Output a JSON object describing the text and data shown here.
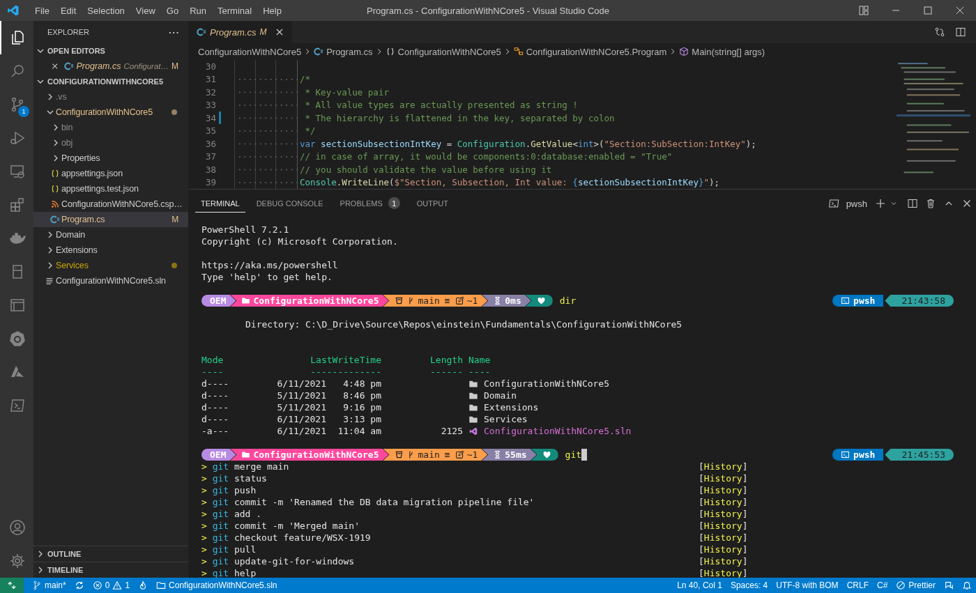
{
  "window": {
    "title": "Program.cs - ConfigurationWithNCore5 - Visual Studio Code"
  },
  "menu": [
    "File",
    "Edit",
    "Selection",
    "View",
    "Go",
    "Run",
    "Terminal",
    "Help"
  ],
  "activity_bar": {
    "top": [
      {
        "kind": "explorer",
        "selected": true
      },
      {
        "kind": "search",
        "selected": false
      },
      {
        "kind": "source_control",
        "selected": false,
        "badge": "1"
      },
      {
        "kind": "run_debug",
        "selected": false
      },
      {
        "kind": "remote",
        "selected": false
      },
      {
        "kind": "extensions",
        "selected": false
      },
      {
        "kind": "docker",
        "selected": false
      },
      {
        "kind": "device",
        "selected": false
      },
      {
        "kind": "window",
        "selected": false
      },
      {
        "kind": "kubernetes",
        "selected": false
      },
      {
        "kind": "azure",
        "selected": false
      },
      {
        "kind": "powershell",
        "selected": false
      }
    ],
    "bottom": [
      {
        "kind": "account"
      },
      {
        "kind": "settings"
      }
    ]
  },
  "sidebar": {
    "title": "EXPLORER",
    "more": "···",
    "open_editors": {
      "title": "OPEN EDITORS",
      "expanded": true,
      "items": [
        {
          "label": "Program.cs",
          "description": "Configurat…",
          "badge": "M",
          "kind": "csharp",
          "selected": false
        }
      ]
    },
    "project": {
      "title": "CONFIGURATIONWITHNCORE5",
      "expanded": true,
      "items": [
        {
          "label": ".vs",
          "kind": "folder",
          "expanded": false,
          "color": "#8c8c8c",
          "dot": false,
          "selected": false
        },
        {
          "label": "ConfigurationWithNCore5",
          "kind": "folder",
          "expanded": true,
          "color": "#e2c08d",
          "dot": true,
          "selected": false,
          "children": [
            {
              "label": "bin",
              "kind": "folder",
              "expanded": false,
              "color": "#8c8c8c",
              "dot": false,
              "selected": false
            },
            {
              "label": "obj",
              "kind": "folder",
              "expanded": false,
              "color": "#8c8c8c",
              "dot": false,
              "selected": false
            },
            {
              "label": "Properties",
              "kind": "folder",
              "expanded": false,
              "color": "#cccccc",
              "dot": false,
              "selected": false
            },
            {
              "label": "appsettings.json",
              "kind": "json",
              "color": "#cccccc",
              "dot": false,
              "selected": false
            },
            {
              "label": "appsettings.test.json",
              "kind": "json",
              "color": "#cccccc",
              "dot": false,
              "selected": false
            },
            {
              "label": "ConfigurationWithNCore5.csp…",
              "kind": "csproj",
              "color": "#cccccc",
              "dot": false,
              "selected": false
            },
            {
              "label": "Program.cs",
              "kind": "csharp",
              "color": "#e2c08d",
              "badge": "M",
              "dot": false,
              "selected": true
            }
          ]
        },
        {
          "label": "Domain",
          "kind": "folder",
          "expanded": false,
          "color": "#cccccc",
          "dot": false,
          "selected": false
        },
        {
          "label": "Extensions",
          "kind": "folder",
          "expanded": false,
          "color": "#cccccc",
          "dot": false,
          "selected": false
        },
        {
          "label": "Services",
          "kind": "folder",
          "expanded": false,
          "color": "#cca700",
          "dot": true,
          "selected": false
        },
        {
          "label": "ConfigurationWithNCore5.sln",
          "kind": "sln",
          "color": "#cccccc",
          "dot": false,
          "selected": false
        }
      ]
    },
    "sections": [
      {
        "title": "OUTLINE",
        "expanded": false
      },
      {
        "title": "TIMELINE",
        "expanded": false
      }
    ]
  },
  "editor": {
    "tabs": [
      {
        "label": "Program.cs",
        "badge": "M",
        "preview": true,
        "selected": true
      }
    ],
    "breadcrumbs": [
      {
        "kind": "folder",
        "text": "ConfigurationWithNCore5"
      },
      {
        "kind": "csharp",
        "text": "Program.cs"
      },
      {
        "kind": "namespace",
        "text": "ConfigurationWithNCore5"
      },
      {
        "kind": "class",
        "text": "ConfigurationWithNCore5.Program"
      },
      {
        "kind": "method",
        "text": "Main(string[] args)"
      }
    ],
    "lines": [
      {
        "number": "30",
        "changed": false
      },
      {
        "number": "31",
        "changed": false,
        "tokens": [
          {
            "kind": "comment",
            "text": "/*"
          }
        ]
      },
      {
        "number": "32",
        "changed": false,
        "tokens": [
          {
            "kind": "comment",
            "text": " * Key-value pair"
          }
        ]
      },
      {
        "number": "33",
        "changed": false,
        "tokens": [
          {
            "kind": "comment",
            "text": " * All value types are actually presented as string !"
          }
        ]
      },
      {
        "number": "34",
        "changed": true,
        "tokens": [
          {
            "kind": "comment",
            "text": " * The hierarchy is flattened in the key, separated by colon"
          }
        ]
      },
      {
        "number": "35",
        "changed": false,
        "tokens": [
          {
            "kind": "comment",
            "text": " */"
          }
        ]
      },
      {
        "number": "36",
        "changed": false,
        "tokens": [
          {
            "kind": "keyword",
            "text": "var"
          },
          {
            "kind": "variable",
            "text": " sectionSubsectionIntKey"
          },
          {
            "kind": "plain",
            "text": " = "
          },
          {
            "kind": "type",
            "text": "Configuration"
          },
          {
            "kind": "plain",
            "text": "."
          },
          {
            "kind": "method",
            "text": "GetValue"
          },
          {
            "kind": "plain",
            "text": "<"
          },
          {
            "kind": "keyword",
            "text": "int"
          },
          {
            "kind": "plain",
            "text": ">("
          },
          {
            "kind": "string",
            "text": "\"Section:SubSection:IntKey\""
          },
          {
            "kind": "plain",
            "text": ");"
          }
        ]
      },
      {
        "number": "37",
        "changed": false,
        "tokens": [
          {
            "kind": "comment",
            "text": "// in case of array, it would be components:0:database:enabled = \"True\""
          }
        ]
      },
      {
        "number": "38",
        "changed": false,
        "tokens": [
          {
            "kind": "comment",
            "text": "// you should validate the value before using it"
          }
        ]
      },
      {
        "number": "39",
        "changed": false,
        "tokens": [
          {
            "kind": "type",
            "text": "Console"
          },
          {
            "kind": "plain",
            "text": "."
          },
          {
            "kind": "method",
            "text": "WriteLine"
          },
          {
            "kind": "plain",
            "text": "("
          },
          {
            "kind": "string",
            "text": "$\"Section, Subsection, Int value: "
          },
          {
            "kind": "keyword",
            "text": "{"
          },
          {
            "kind": "variable",
            "text": "sectionSubsectionIntKey"
          },
          {
            "kind": "keyword",
            "text": "}"
          },
          {
            "kind": "string",
            "text": "\""
          },
          {
            "kind": "plain",
            "text": ");"
          }
        ]
      }
    ]
  },
  "panel": {
    "tabs": [
      {
        "label": "TERMINAL",
        "selected": true
      },
      {
        "label": "DEBUG CONSOLE",
        "selected": false
      },
      {
        "label": "PROBLEMS",
        "selected": false,
        "badge": "1"
      },
      {
        "label": "OUTPUT",
        "selected": false
      }
    ],
    "shell": "pwsh",
    "terminal": [
      {
        "kind": "text",
        "text": "PowerShell 7.2.1"
      },
      {
        "kind": "text",
        "text": "Copyright (c) Microsoft Corporation."
      },
      {
        "kind": "blank"
      },
      {
        "kind": "text",
        "text": "https://aka.ms/powershell"
      },
      {
        "kind": "text",
        "text": "Type 'help' to get help."
      },
      {
        "kind": "blank"
      },
      {
        "kind": "prompt",
        "segments": [
          {
            "kind": "os",
            "color": "#b78ae3",
            "text": "OEM"
          },
          {
            "kind": "path",
            "color": "#ff479c",
            "text": "ConfigurationWithNCore5"
          },
          {
            "kind": "git",
            "color": "#fb9d4b",
            "branch": "main",
            "ahead": "≡",
            "changes": "~1"
          },
          {
            "kind": "duration",
            "color": "#8880a6",
            "text": "0ms"
          },
          {
            "kind": "status",
            "color": "#138a7c"
          }
        ],
        "command": "dir",
        "cursor": false,
        "right": [
          {
            "kind": "shell",
            "color": "#0077c2",
            "text": "pwsh"
          },
          {
            "kind": "time",
            "color": "#2ea29f",
            "text": "21:43:58"
          }
        ]
      },
      {
        "kind": "blank"
      },
      {
        "kind": "heading",
        "text": "Directory: C:\\D_Drive\\Source\\Repos\\einstein\\Fundamentals\\ConfigurationWithNCore5"
      },
      {
        "kind": "blank"
      },
      {
        "kind": "blank"
      },
      {
        "kind": "table_header",
        "mode": "Mode",
        "date": "LastWriteTime",
        "length": "Length",
        "name": "Name"
      },
      {
        "kind": "table_rule",
        "mode": "----",
        "date": "-------------",
        "length": "------",
        "name": "----"
      },
      {
        "kind": "table_row",
        "directory": true,
        "mode": "d----",
        "date": "6/11/2021",
        "time": "4:48 pm",
        "name": "ConfigurationWithNCore5"
      },
      {
        "kind": "table_row",
        "directory": true,
        "mode": "d----",
        "date": "5/11/2021",
        "time": "8:46 pm",
        "name": "Domain"
      },
      {
        "kind": "table_row",
        "directory": true,
        "mode": "d----",
        "date": "5/11/2021",
        "time": "9:16 pm",
        "name": "Extensions"
      },
      {
        "kind": "table_row",
        "directory": true,
        "mode": "d----",
        "date": "6/11/2021",
        "time": "3:13 pm",
        "name": "Services"
      },
      {
        "kind": "table_row",
        "directory": false,
        "mode": "-a---",
        "date": "6/11/2021",
        "time": "11:04 am",
        "length": "2125",
        "name": "ConfigurationWithNCore5.sln"
      },
      {
        "kind": "blank"
      },
      {
        "kind": "prompt",
        "segments": [
          {
            "kind": "os",
            "color": "#b78ae3",
            "text": "OEM"
          },
          {
            "kind": "path",
            "color": "#ff479c",
            "text": "ConfigurationWithNCore5"
          },
          {
            "kind": "git",
            "color": "#fb9d4b",
            "branch": "main",
            "ahead": "≡",
            "changes": "~1"
          },
          {
            "kind": "duration",
            "color": "#8880a6",
            "text": "55ms"
          },
          {
            "kind": "status",
            "color": "#138a7c"
          }
        ],
        "command": "git",
        "cursor": true,
        "right": [
          {
            "kind": "shell",
            "color": "#0077c2",
            "text": "pwsh"
          },
          {
            "kind": "time",
            "color": "#2ea29f",
            "text": "21:45:53"
          }
        ]
      },
      {
        "kind": "history",
        "marker": ">",
        "command": "git",
        "args": "merge main",
        "tag": "[History]"
      },
      {
        "kind": "history",
        "marker": ">",
        "command": "git",
        "args": "status",
        "tag": "[History]"
      },
      {
        "kind": "history",
        "marker": ">",
        "command": "git",
        "args": "push",
        "tag": "[History]"
      },
      {
        "kind": "history",
        "marker": ">",
        "command": "git",
        "args": "commit -m 'Renamed the DB data migration pipeline file'",
        "tag": "[History]"
      },
      {
        "kind": "history",
        "marker": ">",
        "command": "git",
        "args": "add .",
        "tag": "[History]"
      },
      {
        "kind": "history",
        "marker": ">",
        "command": "git",
        "args": "commit -m 'Merged main'",
        "tag": "[History]"
      },
      {
        "kind": "history",
        "marker": ">",
        "command": "git",
        "args": "checkout feature/WSX-1919",
        "tag": "[History]"
      },
      {
        "kind": "history",
        "marker": ">",
        "command": "git",
        "args": "pull",
        "tag": "[History]"
      },
      {
        "kind": "history",
        "marker": ">",
        "command": "git",
        "args": "update-git-for-windows",
        "tag": "[History]"
      },
      {
        "kind": "history",
        "marker": ">",
        "command": "git",
        "args": "help",
        "tag": "[History]"
      }
    ]
  },
  "status_bar": {
    "left": [
      {
        "kind": "remote"
      },
      {
        "kind": "branch",
        "text": "main*"
      },
      {
        "kind": "sync"
      },
      {
        "kind": "problems",
        "errors": "0",
        "warnings": "1"
      },
      {
        "kind": "flame"
      },
      {
        "kind": "folder",
        "text": "ConfigurationWithNCore5.sln"
      }
    ],
    "right": [
      {
        "kind": "text",
        "text": "Ln 40, Col 1"
      },
      {
        "kind": "text",
        "text": "Spaces: 4"
      },
      {
        "kind": "text",
        "text": "UTF-8 with BOM"
      },
      {
        "kind": "text",
        "text": "CRLF"
      },
      {
        "kind": "text",
        "text": "C#"
      },
      {
        "kind": "prettier",
        "text": "Prettier"
      },
      {
        "kind": "feedback"
      },
      {
        "kind": "bell"
      }
    ]
  }
}
